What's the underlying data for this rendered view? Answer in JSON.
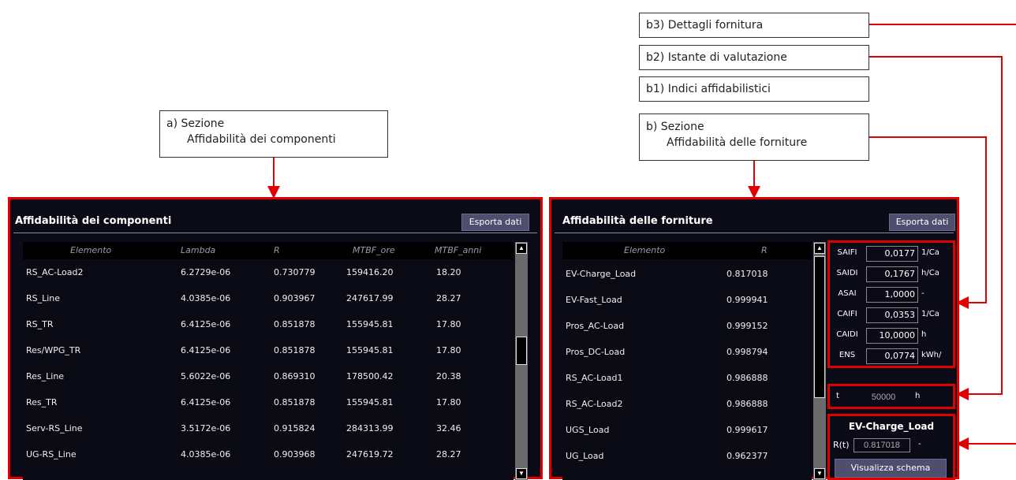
{
  "callouts": {
    "b3": "b3) Dettagli fornitura",
    "b2": "b2) Istante di valutazione",
    "b1": "b1) Indici affidabilistici",
    "b_line1": "b) Sezione",
    "b_line2": "Affidabilità delle forniture",
    "a_line1": "a) Sezione",
    "a_line2": "Affidabilità dei componenti"
  },
  "left_panel": {
    "title": "Affidabilità dei componenti",
    "export_label": "Esporta dati",
    "columns": [
      "Elemento",
      "Lambda",
      "R",
      "MTBF_ore",
      "MTBF_anni"
    ],
    "rows": [
      [
        "RS_AC-Load2",
        "6.2729e-06",
        "0.730779",
        "159416.20",
        "18.20"
      ],
      [
        "RS_Line",
        "4.0385e-06",
        "0.903967",
        "247617.99",
        "28.27"
      ],
      [
        "RS_TR",
        "6.4125e-06",
        "0.851878",
        "155945.81",
        "17.80"
      ],
      [
        "Res/WPG_TR",
        "6.4125e-06",
        "0.851878",
        "155945.81",
        "17.80"
      ],
      [
        "Res_Line",
        "5.6022e-06",
        "0.869310",
        "178500.42",
        "20.38"
      ],
      [
        "Res_TR",
        "6.4125e-06",
        "0.851878",
        "155945.81",
        "17.80"
      ],
      [
        "Serv-RS_Line",
        "3.5172e-06",
        "0.915824",
        "284313.99",
        "32.46"
      ],
      [
        "UG-RS_Line",
        "4.0385e-06",
        "0.903968",
        "247619.72",
        "28.27"
      ]
    ]
  },
  "right_panel": {
    "title": "Affidabilità delle forniture",
    "export_label": "Esporta dati",
    "columns": [
      "Elemento",
      "R"
    ],
    "rows": [
      [
        "EV-Charge_Load",
        "0.817018"
      ],
      [
        "EV-Fast_Load",
        "0.999941"
      ],
      [
        "Pros_AC-Load",
        "0.999152"
      ],
      [
        "Pros_DC-Load",
        "0.998794"
      ],
      [
        "RS_AC-Load1",
        "0.986888"
      ],
      [
        "RS_AC-Load2",
        "0.986888"
      ],
      [
        "UGS_Load",
        "0.999617"
      ],
      [
        "UG_Load",
        "0.962377"
      ]
    ],
    "indices": [
      {
        "label": "SAIFI",
        "value": "0,0177",
        "unit": "1/Ca"
      },
      {
        "label": "SAIDI",
        "value": "0,1767",
        "unit": "h/Ca"
      },
      {
        "label": "ASAI",
        "value": "1,0000",
        "unit": "-"
      },
      {
        "label": "CAIFI",
        "value": "0,0353",
        "unit": "1/Ca"
      },
      {
        "label": "CAIDI",
        "value": "10,0000",
        "unit": "h"
      },
      {
        "label": "ENS",
        "value": "0,0774",
        "unit": "kWh/"
      }
    ],
    "time": {
      "label": "t",
      "value": "50000",
      "unit": "h"
    },
    "supply": {
      "name": "EV-Charge_Load",
      "r_label": "R(t)",
      "r_value": "0.817018",
      "r_unit": "-",
      "button": "Visualizza schema"
    }
  },
  "colors": {
    "accent": "#e00000",
    "panel_bg": "#0b0b18",
    "button": "#4e4e6e"
  }
}
